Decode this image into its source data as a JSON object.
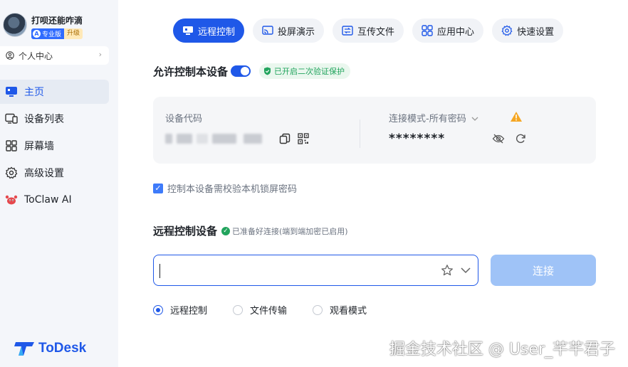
{
  "profile": {
    "username": "打呗还能咋滴",
    "pro_label": "专业版",
    "upgrade_label": "升级"
  },
  "personal_center": {
    "label": "个人中心",
    "chevron": "›"
  },
  "nav": {
    "items": [
      {
        "label": "主页",
        "icon": "monitor-home-icon",
        "active": true
      },
      {
        "label": "设备列表",
        "icon": "devices-icon",
        "active": false
      },
      {
        "label": "屏幕墙",
        "icon": "grid-icon",
        "active": false
      },
      {
        "label": "高级设置",
        "icon": "gear-icon",
        "active": false
      },
      {
        "label": "ToClaw AI",
        "icon": "crab-icon",
        "active": false
      }
    ]
  },
  "logo": {
    "text": "ToDesk"
  },
  "tabs": [
    {
      "label": "远程控制",
      "icon": "monitor-icon",
      "active": true
    },
    {
      "label": "投屏演示",
      "icon": "cast-icon",
      "active": false
    },
    {
      "label": "互传文件",
      "icon": "file-transfer-icon",
      "active": false
    },
    {
      "label": "应用中心",
      "icon": "apps-icon",
      "active": false
    },
    {
      "label": "快速设置",
      "icon": "settings-icon",
      "active": false
    }
  ],
  "allow_control": {
    "title": "允许控制本设备",
    "toggle_on": true,
    "protect_badge": "已开启二次验证保护"
  },
  "device_card": {
    "code_label": "设备代码",
    "mode_label": "连接模式-所有密码",
    "password": "********"
  },
  "lock_check": {
    "label": "控制本设备需校验本机锁屏密码",
    "checked": true
  },
  "remote": {
    "title": "远程控制设备",
    "status": "已准备好连接(端到端加密已启用)",
    "input_value": "",
    "connect_label": "连接",
    "modes": [
      {
        "label": "远程控制",
        "selected": true
      },
      {
        "label": "文件传输",
        "selected": false
      },
      {
        "label": "观看模式",
        "selected": false
      }
    ]
  },
  "watermark": "掘金技术社区 @ User_芊芊君子",
  "colors": {
    "accent": "#1f58e8",
    "success": "#22a45d",
    "warning": "#f5a623",
    "connect_disabled": "#9fc3f7"
  }
}
